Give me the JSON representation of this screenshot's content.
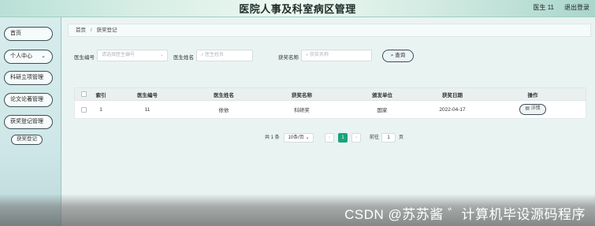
{
  "header": {
    "title": "医院人事及科室病区管理",
    "user": "医生 11",
    "logout": "退出登录"
  },
  "sidebar": {
    "items": [
      {
        "label": "首页"
      },
      {
        "label": "个人中心"
      },
      {
        "label": "科研立项管理"
      },
      {
        "label": "论文论著管理"
      },
      {
        "label": "获奖登记管理"
      }
    ],
    "submenu": {
      "label": "获奖登记"
    }
  },
  "breadcrumb": {
    "home": "首页",
    "separator": "/",
    "current": "获奖登记"
  },
  "filters": {
    "doctor_id_label": "医生编号",
    "doctor_id_placeholder": "请选择医生编号",
    "doctor_name_label": "医生姓名",
    "doctor_name_placeholder": "医生姓名",
    "award_name_label": "获奖名称",
    "award_name_placeholder": "获奖名称",
    "search_label": "查询"
  },
  "table": {
    "headers": [
      "索引",
      "医生编号",
      "医生姓名",
      "获奖名称",
      "颁发单位",
      "获奖日期",
      "操作"
    ],
    "rows": [
      {
        "index": "1",
        "doctor_id": "11",
        "doctor_name": "依依",
        "award": "科研奖",
        "issuer": "国家",
        "date": "2022-04-17",
        "action": "详情"
      }
    ]
  },
  "pagination": {
    "total": "共 1 条",
    "page_size": "10条/页",
    "prev": "‹",
    "current": "1",
    "next": "›",
    "goto_label": "前往",
    "goto_value": "1",
    "page_suffix": "页"
  },
  "watermark": {
    "text": "CSDN @苏苏酱   ゛计算机毕设源码程序"
  },
  "colors": {
    "accent": "#19a37a",
    "border_dark": "#3c4e57"
  }
}
